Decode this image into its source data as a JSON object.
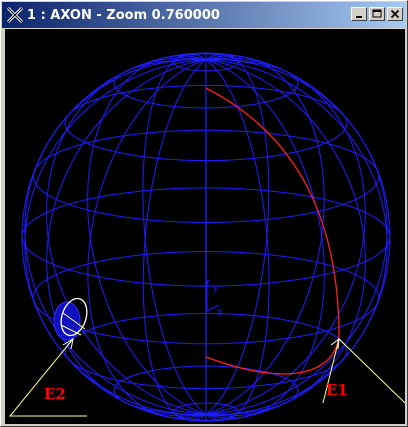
{
  "window": {
    "title": "1 : AXON - Zoom 0.760000",
    "controls": {
      "minimize_icon": "minimize-icon",
      "maximize_icon": "maximize-icon",
      "close_icon": "close-icon"
    }
  },
  "viewport": {
    "background": "#000000",
    "sphere_color": "#1e1eff",
    "curve_color": "#ff2020",
    "pointer_color": "#ffff80",
    "label_color": "#ff0000",
    "axis_labels": {
      "y": "y",
      "x": "x",
      "z": "z"
    },
    "labels": {
      "e1": "E1",
      "e2": "E2"
    }
  }
}
